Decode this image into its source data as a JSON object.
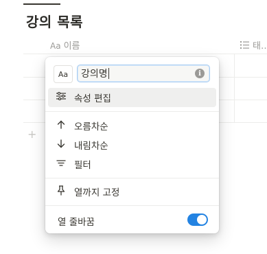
{
  "database": {
    "title": "강의 목록",
    "columns": [
      {
        "icon": "text-type-icon",
        "icon_glyph": "Aa",
        "label": "이름"
      },
      {
        "icon": "list-icon",
        "label": "태…"
      }
    ],
    "new_row_icon": "+"
  },
  "menu": {
    "icon_picker_label": "Aa",
    "name_value": "강의명",
    "items": {
      "edit_property": "속성 편집",
      "sort_asc": "오름차순",
      "sort_desc": "내림차순",
      "filter": "필터",
      "freeze": "열까지 고정",
      "wrap_column": "열 줄바꿈"
    },
    "wrap_enabled": true
  },
  "colors": {
    "accent": "#2383e2",
    "text": "#37352f",
    "muted": "#9b9a97"
  }
}
